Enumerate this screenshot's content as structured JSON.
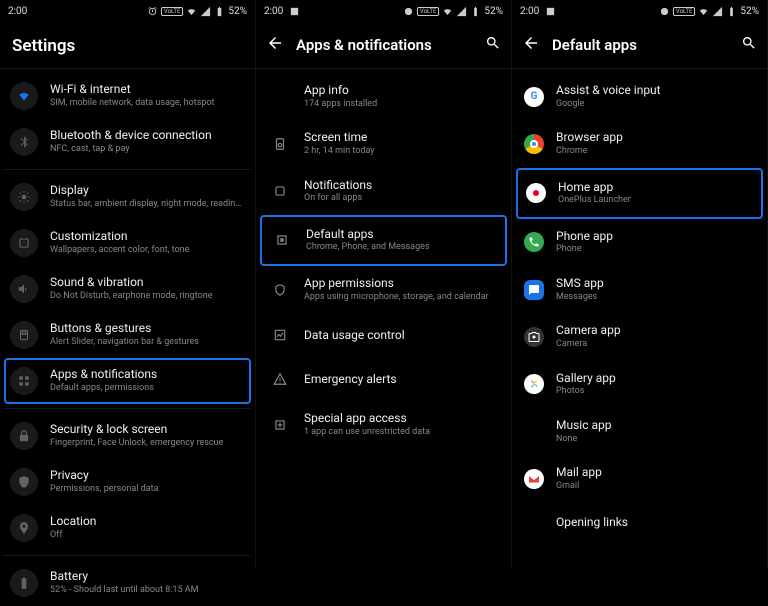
{
  "status": {
    "time": "2:00",
    "battery": "52%"
  },
  "screen1": {
    "title": "Settings",
    "items": [
      {
        "title": "Wi-Fi & internet",
        "sub": "SIM, mobile network, data usage, hotspot"
      },
      {
        "title": "Bluetooth & device connection",
        "sub": "NFC, cast, tap & pay"
      },
      {
        "title": "Display",
        "sub": "Status bar, ambient display, night mode, reading mode"
      },
      {
        "title": "Customization",
        "sub": "Wallpapers, accent color, font, tone"
      },
      {
        "title": "Sound & vibration",
        "sub": "Do Not Disturb, earphone mode, ringtone"
      },
      {
        "title": "Buttons & gestures",
        "sub": "Alert Slider, navigation bar & gestures"
      },
      {
        "title": "Apps & notifications",
        "sub": "Default apps, permissions"
      },
      {
        "title": "Security & lock screen",
        "sub": "Fingerprint, Face Unlock, emergency rescue"
      },
      {
        "title": "Privacy",
        "sub": "Permissions, personal data"
      },
      {
        "title": "Location",
        "sub": "Off"
      },
      {
        "title": "Battery",
        "sub": "52% - Should last until about 8:15 AM"
      }
    ]
  },
  "screen2": {
    "title": "Apps & notifications",
    "items": [
      {
        "title": "App info",
        "sub": "174 apps installed"
      },
      {
        "title": "Screen time",
        "sub": "2 hr, 14 min today"
      },
      {
        "title": "Notifications",
        "sub": "On for all apps"
      },
      {
        "title": "Default apps",
        "sub": "Chrome, Phone, and Messages"
      },
      {
        "title": "App permissions",
        "sub": "Apps using microphone, storage, and calendar"
      },
      {
        "title": "Data usage control",
        "sub": ""
      },
      {
        "title": "Emergency alerts",
        "sub": ""
      },
      {
        "title": "Special app access",
        "sub": "1 app can use unrestricted data"
      }
    ]
  },
  "screen3": {
    "title": "Default apps",
    "items": [
      {
        "title": "Assist & voice input",
        "sub": "Google"
      },
      {
        "title": "Browser app",
        "sub": "Chrome"
      },
      {
        "title": "Home app",
        "sub": "OnePlus Launcher"
      },
      {
        "title": "Phone app",
        "sub": "Phone"
      },
      {
        "title": "SMS app",
        "sub": "Messages"
      },
      {
        "title": "Camera app",
        "sub": "Camera"
      },
      {
        "title": "Gallery app",
        "sub": "Photos"
      },
      {
        "title": "Music app",
        "sub": "None"
      },
      {
        "title": "Mail app",
        "sub": "Gmail"
      },
      {
        "title": "Opening links",
        "sub": ""
      }
    ]
  },
  "colors": {
    "highlight": "#1a73e8"
  }
}
